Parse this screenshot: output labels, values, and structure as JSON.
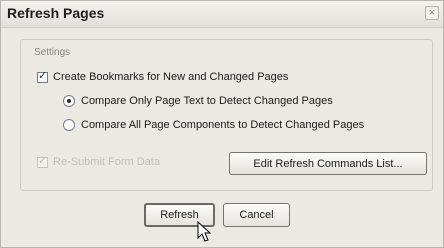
{
  "window": {
    "title": "Refresh Pages",
    "close_glyph": "×"
  },
  "settings": {
    "group_label": "Settings",
    "create_bookmarks": {
      "label": "Create Bookmarks for New and Changed Pages",
      "checked": true
    },
    "compare_options": [
      {
        "label": "Compare Only Page Text to Detect Changed Pages",
        "selected": true
      },
      {
        "label": "Compare All Page Components to Detect Changed Pages",
        "selected": false
      }
    ],
    "resubmit_form_data": {
      "label": "Re-Submit Form Data",
      "checked": true,
      "enabled": false
    },
    "edit_commands_label": "Edit Refresh Commands List..."
  },
  "buttons": {
    "refresh_label": "Refresh",
    "cancel_label": "Cancel"
  },
  "icons": {
    "check": "✓",
    "cursor": "arrow-pointer-icon"
  }
}
